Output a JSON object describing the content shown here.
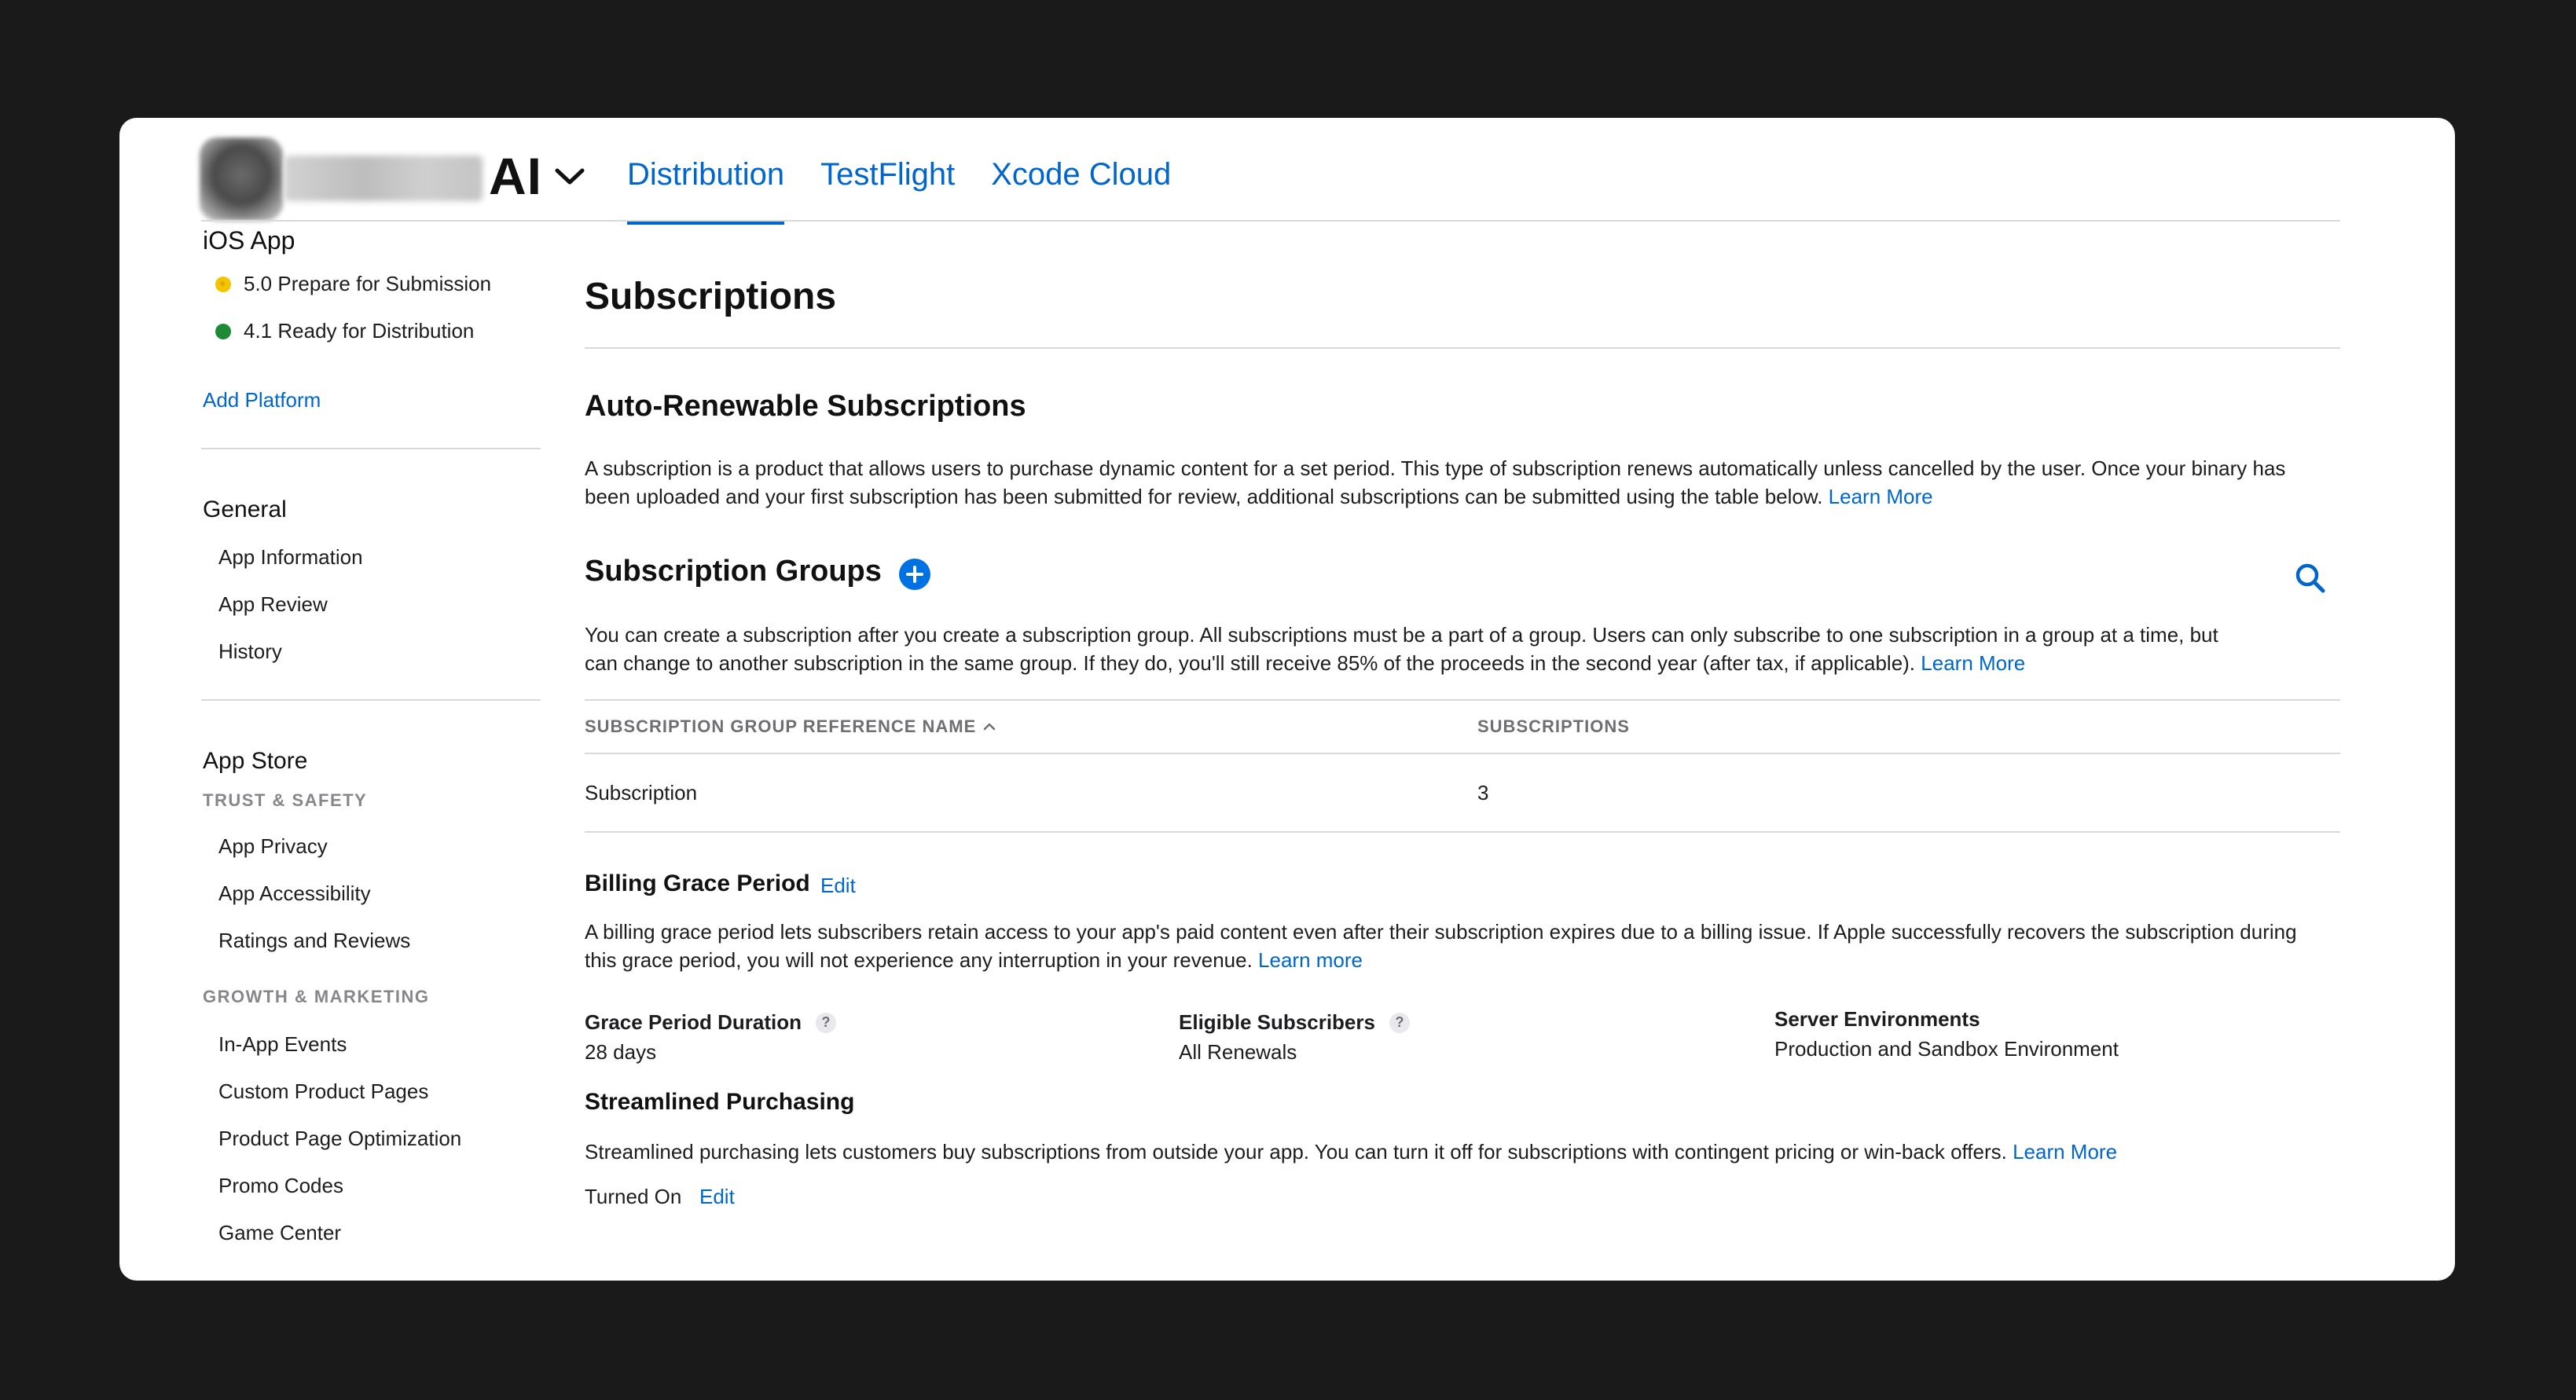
{
  "header": {
    "app_name_suffix": "AI",
    "tabs": [
      {
        "label": "Distribution",
        "active": true
      },
      {
        "label": "TestFlight",
        "active": false
      },
      {
        "label": "Xcode Cloud",
        "active": false
      }
    ]
  },
  "sidebar": {
    "platform": "iOS App",
    "versions": [
      {
        "label": "5.0 Prepare for Submission",
        "status_color": "#f5c400"
      },
      {
        "label": "4.1 Ready for Distribution",
        "status_color": "#1d8a37"
      }
    ],
    "add_platform": "Add Platform",
    "general": {
      "title": "General",
      "items": [
        "App Information",
        "App Review",
        "History"
      ]
    },
    "app_store": {
      "title": "App Store",
      "trust_safety": {
        "title": "TRUST & SAFETY",
        "items": [
          "App Privacy",
          "App Accessibility",
          "Ratings and Reviews"
        ]
      },
      "growth_marketing": {
        "title": "GROWTH & MARKETING",
        "items": [
          "In-App Events",
          "Custom Product Pages",
          "Product Page Optimization",
          "Promo Codes",
          "Game Center"
        ]
      }
    }
  },
  "main": {
    "title": "Subscriptions",
    "auto_renewable": {
      "title": "Auto-Renewable Subscriptions",
      "description": "A subscription is a product that allows users to purchase dynamic content for a set period. This type of subscription renews automatically unless cancelled by the user. Once your binary has been uploaded and your first subscription has been submitted for review, additional subscriptions can be submitted using the table below.",
      "learn_more": "Learn More"
    },
    "groups": {
      "title": "Subscription Groups",
      "description": "You can create a subscription after you create a subscription group. All subscriptions must be a part of a group. Users can only subscribe to one subscription in a group at a time, but can change to another subscription in the same group. If they do, you'll still receive 85% of the proceeds in the second year (after tax, if applicable).",
      "learn_more": "Learn More",
      "columns": {
        "name": "SUBSCRIPTION GROUP REFERENCE NAME",
        "count": "SUBSCRIPTIONS"
      },
      "rows": [
        {
          "name": "Subscription",
          "count": "3"
        }
      ]
    },
    "billing": {
      "title": "Billing Grace Period",
      "edit": "Edit",
      "description": "A billing grace period lets subscribers retain access to your app's paid content even after their subscription expires due to a billing issue. If Apple successfully recovers the subscription during this grace period, you will not experience any interruption in your revenue.",
      "learn_more": "Learn more",
      "fields": {
        "duration_label": "Grace Period Duration",
        "duration_value": "28 days",
        "eligible_label": "Eligible Subscribers",
        "eligible_value": "All Renewals",
        "env_label": "Server Environments",
        "env_value": "Production and Sandbox Environment"
      },
      "help_glyph": "?"
    },
    "streamlined": {
      "title": "Streamlined Purchasing",
      "description": "Streamlined purchasing lets customers buy subscriptions from outside your app. You can turn it off for subscriptions with contingent pricing or win-back offers.",
      "learn_more": "Learn More",
      "status": "Turned On",
      "edit": "Edit"
    }
  },
  "colors": {
    "accent": "#0066cc",
    "background": "#1a1a1a",
    "divider": "#d9d9dd"
  },
  "icons": {
    "app_switcher": "chevron-down-icon",
    "add_group": "plus-circle-icon",
    "search": "search-icon",
    "sort": "chevron-up-icon"
  }
}
